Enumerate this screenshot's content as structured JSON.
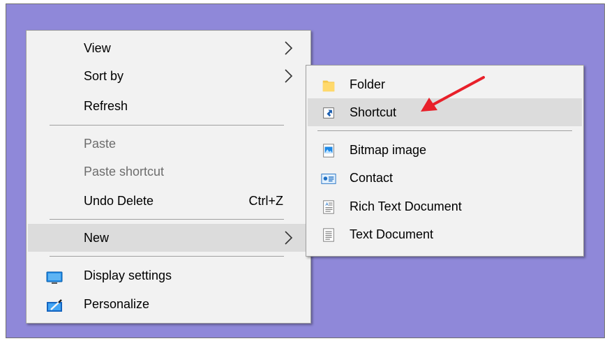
{
  "context_menu": {
    "items": [
      {
        "label": "View"
      },
      {
        "label": "Sort by"
      },
      {
        "label": "Refresh"
      },
      {
        "label": "Paste"
      },
      {
        "label": "Paste shortcut"
      },
      {
        "label": "Undo Delete",
        "shortcut": "Ctrl+Z"
      },
      {
        "label": "New"
      },
      {
        "label": "Display settings",
        "icon": "display-icon"
      },
      {
        "label": "Personalize",
        "icon": "personalize-icon"
      }
    ]
  },
  "new_submenu": {
    "items": [
      {
        "label": "Folder",
        "icon": "folder-icon"
      },
      {
        "label": "Shortcut",
        "icon": "shortcut-icon"
      },
      {
        "label": "Bitmap image",
        "icon": "bitmap-icon"
      },
      {
        "label": "Contact",
        "icon": "contact-icon"
      },
      {
        "label": "Rich Text Document",
        "icon": "rich-text-icon"
      },
      {
        "label": "Text Document",
        "icon": "text-document-icon"
      }
    ]
  },
  "colors": {
    "desktop": "#8f88d9",
    "menu_bg": "#f2f2f2",
    "highlight": "#dcdcdc",
    "disabled_text": "#6d6d6d",
    "annotation_arrow": "#e8202a"
  }
}
